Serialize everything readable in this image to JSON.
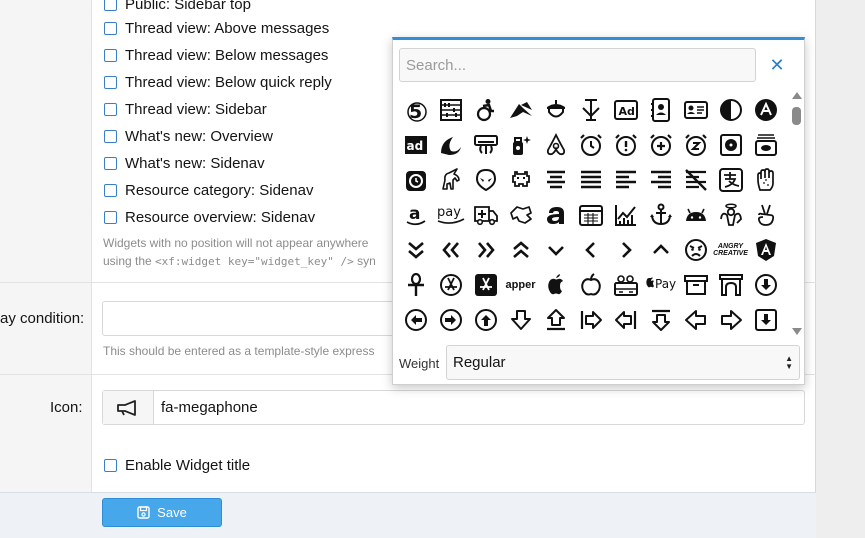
{
  "checkbox_options": [
    "Public: Sidebar top",
    "Thread view: Above messages",
    "Thread view: Below messages",
    "Thread view: Below quick reply",
    "Thread view: Sidebar",
    "What's new: Overview",
    "What's new: Sidenav",
    "Resource category: Sidenav",
    "Resource overview: Sidenav"
  ],
  "positions_hint": {
    "line1": "Widgets with no position will not appear anywhere",
    "line2_prefix": "using the ",
    "line2_code": "<xf:widget key=\"widget_key\" />",
    "line2_suffix": " syn"
  },
  "display_condition": {
    "label": "ay condition:",
    "value": "",
    "hint": "This should be entered as a template-style express"
  },
  "icon_field": {
    "label": "Icon:",
    "value": "fa-megaphone",
    "addon_icon": "megaphone-icon"
  },
  "widget_title_checkbox": {
    "label": "Enable Widget title"
  },
  "save_button": {
    "label": "Save",
    "icon": "save-icon"
  },
  "icon_picker": {
    "search_placeholder": "Search...",
    "close_icon": "close-icon",
    "weight_label": "Weight",
    "weight_value": "Regular",
    "text_icons": {
      "ad": "Ad",
      "adn": "ad",
      "amazon": "a",
      "amazon_pay": "pay",
      "app_logo": "apper",
      "apple_pay": "Pay",
      "angry_creative_top": "ANGRY",
      "angry_creative_bottom": "CREATIVE"
    },
    "icons": [
      "500px-icon",
      "abacus-icon",
      "accessible-icon",
      "accusoft-icon",
      "acorn-icon",
      "acquisitions-incorporated-icon",
      "ad-icon",
      "address-book-icon",
      "address-card-icon",
      "adjust-icon",
      "affiliatetheme-icon",
      "adn-icon",
      "adversal-icon",
      "air-conditioner-icon",
      "air-freshener-icon",
      "airbnb-icon",
      "alarm-clock-icon",
      "alarm-exclamation-icon",
      "alarm-plus-icon",
      "alarm-snooze-icon",
      "album-icon",
      "album-collection-icon",
      "alarm-timer-icon",
      "alicorn-icon",
      "alien-icon",
      "alien-monster-icon",
      "align-center-icon",
      "align-justify-icon",
      "align-left-icon",
      "align-right-icon",
      "align-slash-icon",
      "alipay-icon",
      "allergies-icon",
      "amazon-icon",
      "amazon-pay-icon",
      "ambulance-icon",
      "american-sign-language-icon",
      "amilia-icon",
      "analytics-icon",
      "chart-line-icon",
      "anchor-icon",
      "android-icon",
      "angel-icon",
      "angellist-icon",
      "angle-double-down-icon",
      "angle-double-left-icon",
      "angle-double-right-icon",
      "angle-double-up-icon",
      "angle-down-icon",
      "angle-left-icon",
      "angle-right-icon",
      "angle-up-icon",
      "angry-icon",
      "angrycreative-icon",
      "angular-icon",
      "ankh-icon",
      "app-store-icon",
      "app-store-ios-icon",
      "apper-icon",
      "apple-icon",
      "apple-alt-icon",
      "apple-crate-icon",
      "apple-pay-icon",
      "archive-icon",
      "archway-icon",
      "arrow-alt-circle-down-icon",
      "arrow-alt-circle-left-icon",
      "arrow-alt-circle-right-icon",
      "arrow-alt-circle-up-icon",
      "arrow-alt-down-icon",
      "arrow-alt-from-bottom-icon",
      "arrow-alt-from-left-icon",
      "arrow-alt-from-right-icon",
      "arrow-alt-from-top-icon",
      "arrow-alt-left-icon",
      "arrow-alt-right-icon",
      "arrow-alt-square-down-icon"
    ]
  }
}
